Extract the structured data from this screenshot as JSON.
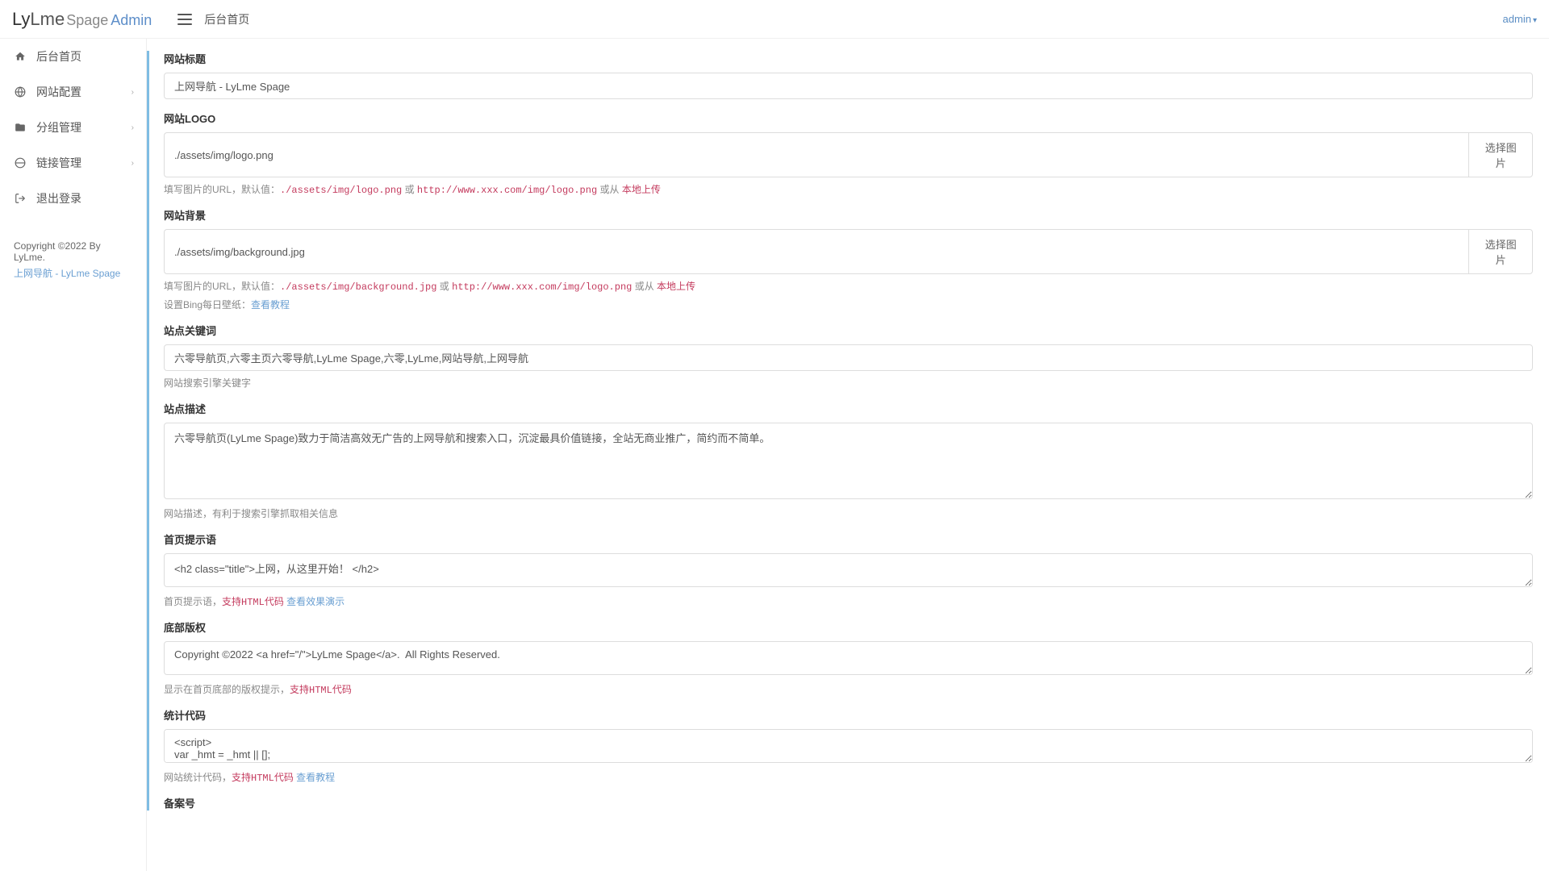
{
  "header": {
    "logo_ly": "Ly",
    "logo_lme": "Lme",
    "logo_spage": "Spage",
    "logo_admin": "Admin",
    "breadcrumb": "后台首页",
    "user": "admin"
  },
  "sidebar": {
    "items": [
      {
        "label": "后台首页",
        "has_arrow": false
      },
      {
        "label": "网站配置",
        "has_arrow": true
      },
      {
        "label": "分组管理",
        "has_arrow": true
      },
      {
        "label": "链接管理",
        "has_arrow": true
      },
      {
        "label": "退出登录",
        "has_arrow": false
      }
    ],
    "footer_copyright": "Copyright ©2022 By LyLme.",
    "footer_link": "上网导航 - LyLme Spage"
  },
  "form": {
    "site_title": {
      "label": "网站标题",
      "value": "上网导航 - LyLme Spage"
    },
    "site_logo": {
      "label": "网站LOGO",
      "value": "./assets/img/logo.png",
      "select_btn": "选择图片",
      "help_prefix": "填写图片的URL，默认值：",
      "code1": "./assets/img/logo.png",
      "or": " 或 ",
      "code2": "http://www.xxx.com/img/logo.png",
      "or_from": " 或从 ",
      "upload": "本地上传"
    },
    "site_bg": {
      "label": "网站背景",
      "value": "./assets/img/background.jpg",
      "select_btn": "选择图片",
      "help_prefix": "填写图片的URL，默认值：",
      "code1": "./assets/img/background.jpg",
      "or": " 或 ",
      "code2": "http://www.xxx.com/img/logo.png",
      "or_from": " 或从 ",
      "upload": "本地上传",
      "bing_prefix": "设置Bing每日壁纸：",
      "bing_link": "查看教程"
    },
    "site_keywords": {
      "label": "站点关键词",
      "value": "六零导航页,六零主页六零导航,LyLme Spage,六零,LyLme,网站导航,上网导航",
      "help": "网站搜索引擎关键字"
    },
    "site_desc": {
      "label": "站点描述",
      "value": "六零导航页(LyLme Spage)致力于简洁高效无广告的上网导航和搜索入口，沉淀最具价值链接，全站无商业推广，简约而不简单。",
      "help": "网站描述，有利于搜索引擎抓取相关信息"
    },
    "home_tip": {
      "label": "首页提示语",
      "value": "<h2 class=\"title\">上网，从这里开始！ </h2>",
      "help_prefix": "首页提示语，",
      "html_support": "支持HTML代码",
      "demo_link": " 查看效果演示"
    },
    "footer_copyright": {
      "label": "底部版权",
      "value": "Copyright ©2022 <a href=\"/\">LyLme Spage</a>.  All Rights Reserved.",
      "help_prefix": "显示在首页底部的版权提示，",
      "html_support": "支持HTML代码"
    },
    "stat_code": {
      "label": "统计代码",
      "value": "<script>\nvar _hmt = _hmt || [];",
      "help_prefix": "网站统计代码，",
      "html_support": "支持HTML代码",
      "tutorial": " 查看教程"
    },
    "icp": {
      "label": "备案号"
    }
  }
}
